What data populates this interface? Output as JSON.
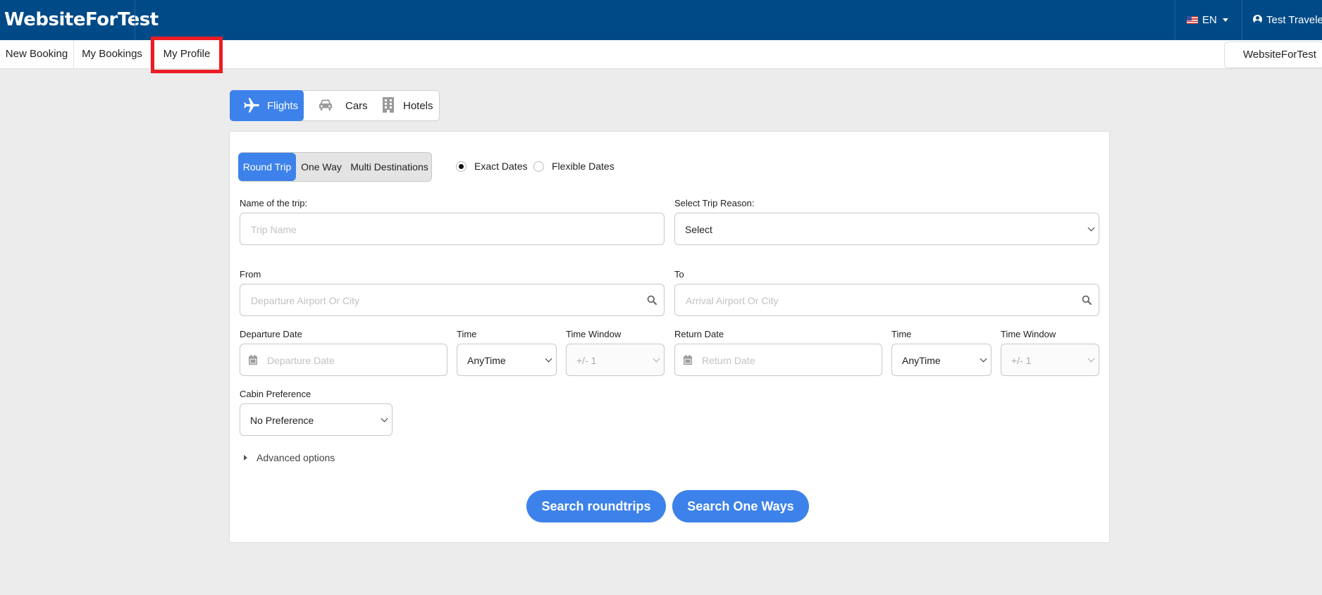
{
  "header": {
    "brand": "WebsiteForTest",
    "language": "EN",
    "user": "Test Traveler"
  },
  "nav": {
    "items": [
      "New Booking",
      "My Bookings",
      "My Profile"
    ],
    "right_label": "WebsiteForTest"
  },
  "modes": {
    "flights": "Flights",
    "cars": "Cars",
    "hotels": "Hotels"
  },
  "trip_type": {
    "round_trip": "Round Trip",
    "one_way": "One Way",
    "multi": "Multi Destinations"
  },
  "date_mode": {
    "exact": "Exact Dates",
    "flexible": "Flexible Dates"
  },
  "form": {
    "trip_name_label": "Name of the trip:",
    "trip_name_placeholder": "Trip Name",
    "reason_label": "Select Trip Reason:",
    "reason_value": "Select",
    "from_label": "From",
    "from_placeholder": "Departure Airport Or City",
    "to_label": "To",
    "to_placeholder": "Arrival Airport Or City",
    "dep_date_label": "Departure Date",
    "dep_date_placeholder": "Departure Date",
    "dep_time_label": "Time",
    "dep_time_value": "AnyTime",
    "dep_window_label": "Time Window",
    "dep_window_value": "+/- 1",
    "ret_date_label": "Return Date",
    "ret_date_placeholder": "Return Date",
    "ret_time_label": "Time",
    "ret_time_value": "AnyTime",
    "ret_window_label": "Time Window",
    "ret_window_value": "+/- 1",
    "cabin_label": "Cabin Preference",
    "cabin_value": "No Preference",
    "advanced": "Advanced options"
  },
  "buttons": {
    "roundtrips": "Search roundtrips",
    "oneways": "Search One Ways"
  },
  "colors": {
    "header_bg": "#004a87",
    "accent": "#3d82ea",
    "highlight": "#ec1c24"
  }
}
